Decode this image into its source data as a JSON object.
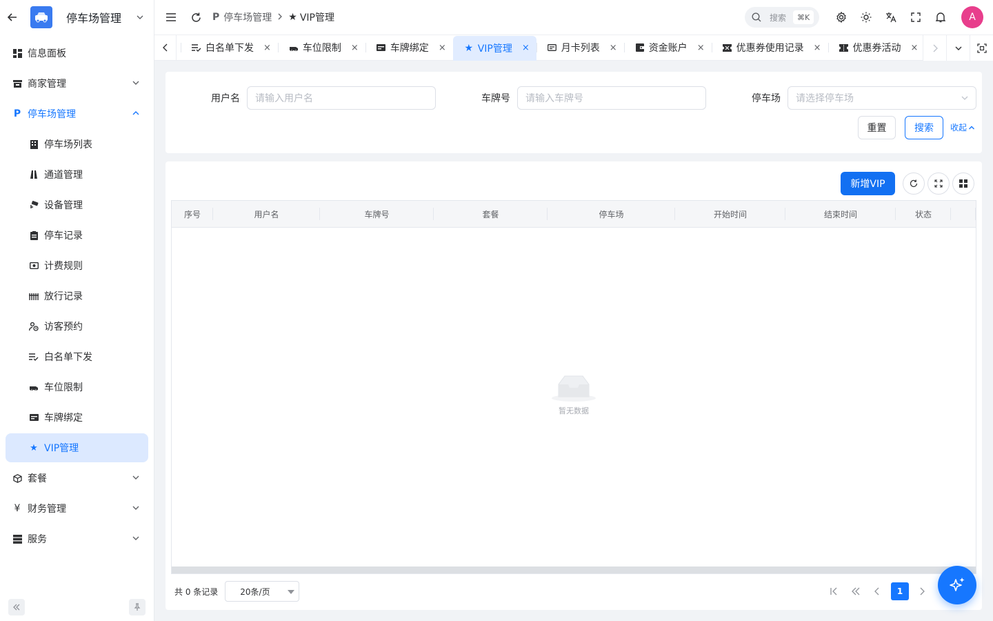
{
  "sidebar": {
    "title": "停车场管理",
    "menu": [
      {
        "label": "信息面板",
        "icon": "dashboard-icon"
      },
      {
        "label": "商家管理",
        "icon": "store-icon"
      },
      {
        "label": "停车场管理",
        "icon": "parking-icon"
      },
      {
        "label": "停车场列表",
        "icon": "building-icon"
      },
      {
        "label": "通道管理",
        "icon": "road-icon"
      },
      {
        "label": "设备管理",
        "icon": "camera-icon"
      },
      {
        "label": "停车记录",
        "icon": "clipboard-icon"
      },
      {
        "label": "计费规则",
        "icon": "money-icon"
      },
      {
        "label": "放行记录",
        "icon": "gate-icon"
      },
      {
        "label": "访客预约",
        "icon": "visitor-icon"
      },
      {
        "label": "白名单下发",
        "icon": "list-check-icon"
      },
      {
        "label": "车位限制",
        "icon": "car-icon"
      },
      {
        "label": "车牌绑定",
        "icon": "plate-icon"
      },
      {
        "label": "VIP管理",
        "icon": "star-icon"
      },
      {
        "label": "套餐",
        "icon": "package-icon"
      },
      {
        "label": "财务管理",
        "icon": "yen-icon"
      },
      {
        "label": "服务",
        "icon": "server-icon"
      }
    ]
  },
  "header": {
    "breadcrumb": [
      "停车场管理",
      "VIP管理"
    ],
    "search_label": "搜索",
    "search_kbd": "⌘K",
    "avatar": "A"
  },
  "tabs": [
    {
      "label": "白名单下发",
      "icon": "list-check-icon"
    },
    {
      "label": "车位限制",
      "icon": "car-icon"
    },
    {
      "label": "车牌绑定",
      "icon": "plate-icon"
    },
    {
      "label": "VIP管理",
      "icon": "star-icon",
      "active": true
    },
    {
      "label": "月卡列表",
      "icon": "card-icon"
    },
    {
      "label": "资金账户",
      "icon": "wallet-icon"
    },
    {
      "label": "优惠券使用记录",
      "icon": "ticket-icon"
    },
    {
      "label": "优惠券活动",
      "icon": "ticket-icon"
    }
  ],
  "filter": {
    "username_label": "用户名",
    "username_placeholder": "请输入用户名",
    "plate_label": "车牌号",
    "plate_placeholder": "请输入车牌号",
    "lot_label": "停车场",
    "lot_placeholder": "请选择停车场",
    "reset": "重置",
    "search": "搜索",
    "collapse": "收起"
  },
  "table": {
    "add_button": "新增VIP",
    "columns": [
      "序号",
      "用户名",
      "车牌号",
      "套餐",
      "停车场",
      "开始时间",
      "结束时间",
      "状态"
    ],
    "rows": [],
    "empty_text": "暂无数据"
  },
  "pagination": {
    "total_text": "共 0 条记录",
    "page_size": "20条/页",
    "current_page": "1"
  },
  "colors": {
    "primary": "#1677ff",
    "active_bg": "#dce9ff"
  }
}
